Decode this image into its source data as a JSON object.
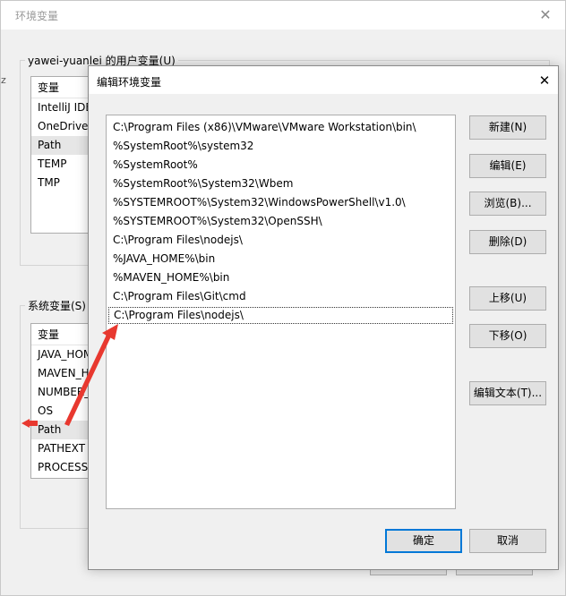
{
  "outer_window": {
    "title": "环境变量",
    "left_clip_text": "z",
    "user_group_label": "yawei-yuanlei 的用户变量(U)",
    "user_list": {
      "header": "变量",
      "items": [
        "IntelliJ IDE",
        "OneDrive",
        "Path",
        "TEMP",
        "TMP"
      ]
    },
    "sys_group_label": "系统变量(S)",
    "sys_list": {
      "header": "变量",
      "items": [
        "JAVA_HOM",
        "MAVEN_H",
        "NUMBER_",
        "OS",
        "Path",
        "PATHEXT",
        "PROCESSO"
      ]
    }
  },
  "dialog": {
    "title": "编辑环境变量",
    "paths": [
      "C:\\Program Files (x86)\\VMware\\VMware Workstation\\bin\\",
      "%SystemRoot%\\system32",
      "%SystemRoot%",
      "%SystemRoot%\\System32\\Wbem",
      "%SYSTEMROOT%\\System32\\WindowsPowerShell\\v1.0\\",
      "%SYSTEMROOT%\\System32\\OpenSSH\\",
      "C:\\Program Files\\nodejs\\",
      "%JAVA_HOME%\\bin",
      "%MAVEN_HOME%\\bin",
      "C:\\Program Files\\Git\\cmd",
      "C:\\Program Files\\nodejs\\"
    ],
    "buttons": {
      "new": "新建(N)",
      "edit": "编辑(E)",
      "browse": "浏览(B)...",
      "delete": "删除(D)",
      "move_up": "上移(U)",
      "move_down": "下移(O)",
      "edit_text": "编辑文本(T)...",
      "ok": "确定",
      "cancel": "取消"
    }
  },
  "colors": {
    "annotation_arrow": "#e8382f",
    "primary_button_border": "#0078d7"
  }
}
